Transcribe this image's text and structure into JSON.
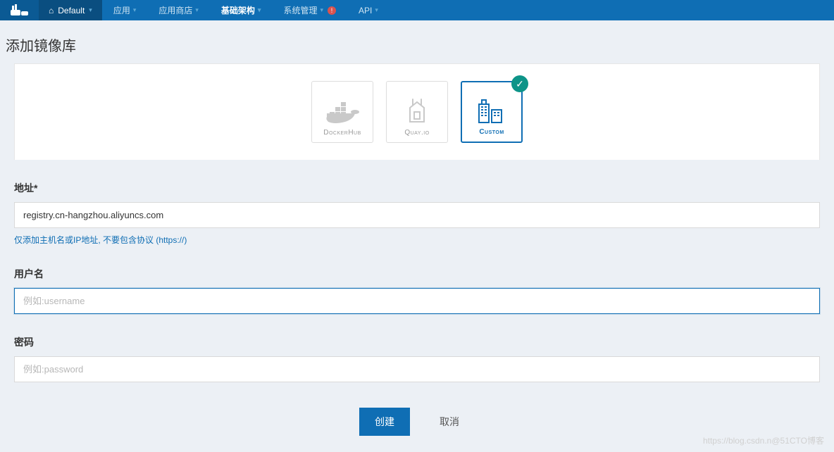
{
  "nav": {
    "env_label": "Default",
    "items": [
      {
        "label": "应用",
        "active": false
      },
      {
        "label": "应用商店",
        "active": false
      },
      {
        "label": "基础架构",
        "active": true
      },
      {
        "label": "系统管理",
        "active": false,
        "alert": "!"
      },
      {
        "label": "API",
        "active": false
      }
    ]
  },
  "page": {
    "title": "添加镜像库"
  },
  "registries": [
    {
      "id": "dockerhub",
      "label": "DockerHub",
      "selected": false
    },
    {
      "id": "quay",
      "label": "Quay.io",
      "selected": false
    },
    {
      "id": "custom",
      "label": "Custom",
      "selected": true
    }
  ],
  "form": {
    "address": {
      "label": "地址*",
      "value": "registry.cn-hangzhou.aliyuncs.com",
      "hint": "仅添加主机名或IP地址, 不要包含协议 (https://)"
    },
    "username": {
      "label": "用户名",
      "value": "",
      "placeholder": "例如:username"
    },
    "password": {
      "label": "密码",
      "value": "",
      "placeholder": "例如:password"
    }
  },
  "buttons": {
    "create": "创建",
    "cancel": "取消"
  },
  "watermark": "https://blog.csdn.n@51CTO博客"
}
